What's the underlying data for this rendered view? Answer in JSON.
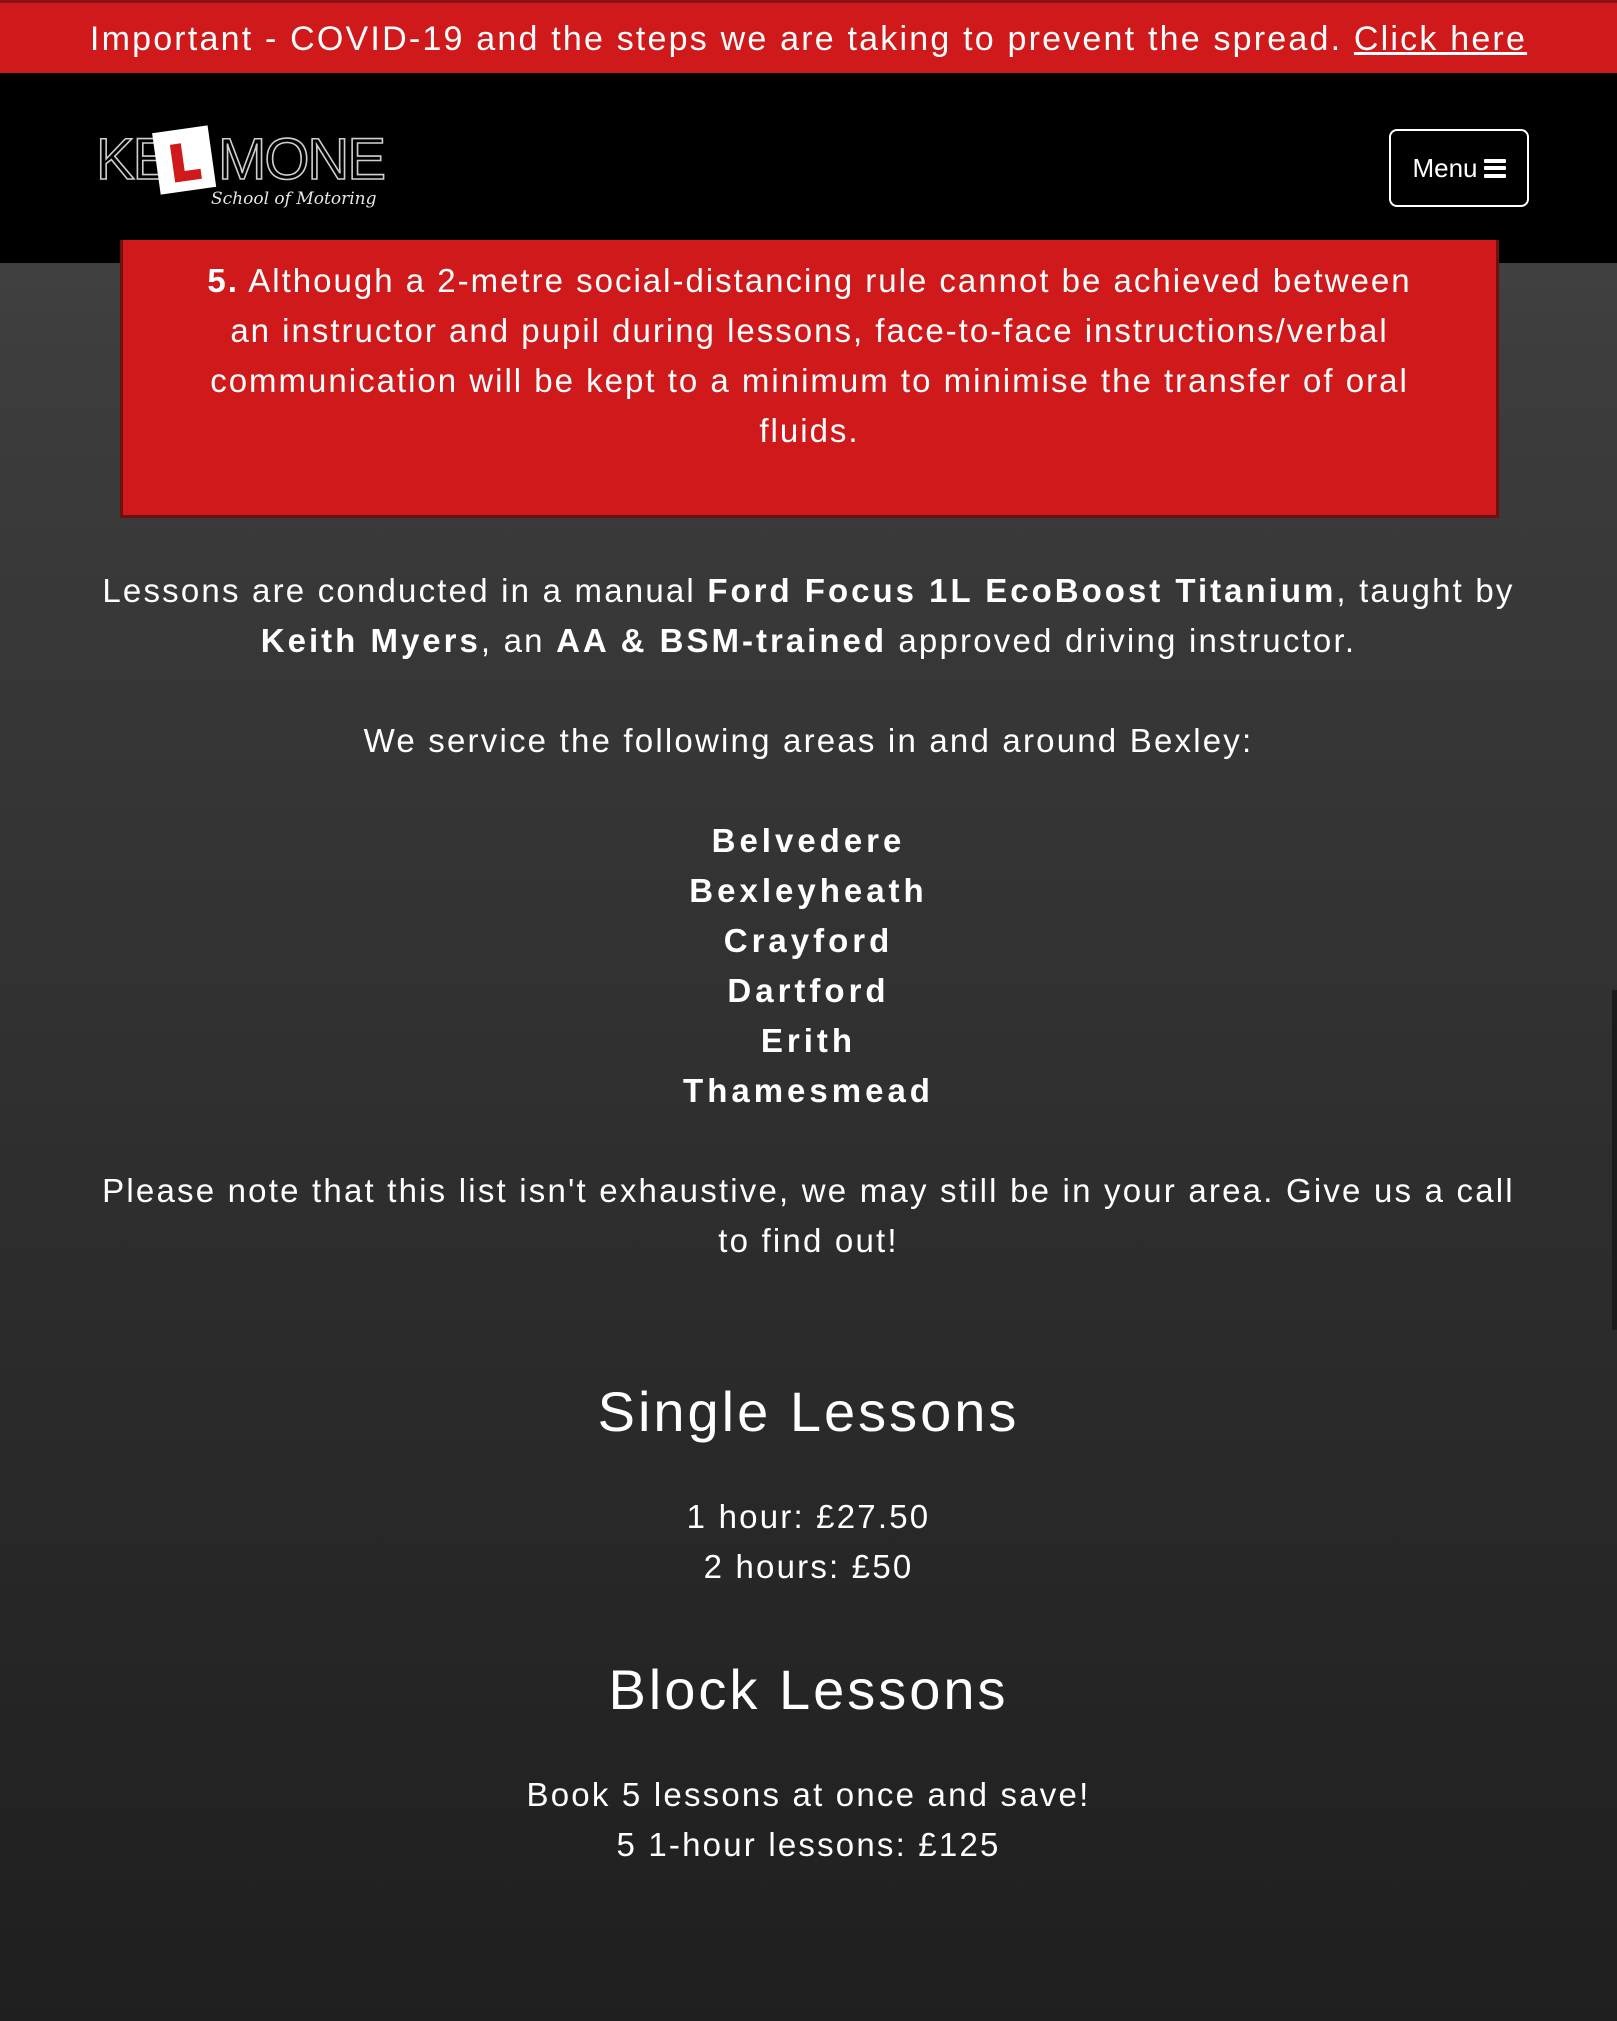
{
  "banner": {
    "text": "Important - COVID-19 and the steps we are taking to prevent the spread. ",
    "link": "Click here"
  },
  "header": {
    "logo": {
      "left": "KE",
      "right": "MONE",
      "badge_letter": "L",
      "tagline": "School of Motoring"
    },
    "menu_label": "Menu",
    "menu_icon": "hamburger-icon"
  },
  "notice": {
    "number": "5.",
    "text": " Although a 2-metre social-distancing rule cannot be achieved between an instructor and pupil during lessons, face-to-face instructions/verbal communication will be kept to a minimum to minimise the transfer of oral fluids."
  },
  "intro": {
    "p1_a": "Lessons are conducted in a manual ",
    "p1_car": "Ford Focus 1L EcoBoost Titanium",
    "p1_b": ", taught by ",
    "p1_name": "Keith Myers",
    "p1_c": ", an ",
    "p1_cred": "AA & BSM-trained",
    "p1_d": " approved driving instructor.",
    "areas_intro": "We service the following areas in and around Bexley:",
    "areas": [
      "Belvedere",
      "Bexleyheath",
      "Crayford",
      "Dartford",
      "Erith",
      "Thamesmead"
    ],
    "note": "Please note that this list isn't exhaustive, we may still be in your area. Give us a call to find out!"
  },
  "single": {
    "title": "Single Lessons",
    "line1": "1 hour: £27.50",
    "line2": "2 hours: £50"
  },
  "block": {
    "title": "Block Lessons",
    "line1": "Book 5 lessons at once and save!",
    "line2": "5 1-hour lessons: £125"
  },
  "colors": {
    "accent_red": "#d0191b",
    "header_bg": "#000000"
  }
}
